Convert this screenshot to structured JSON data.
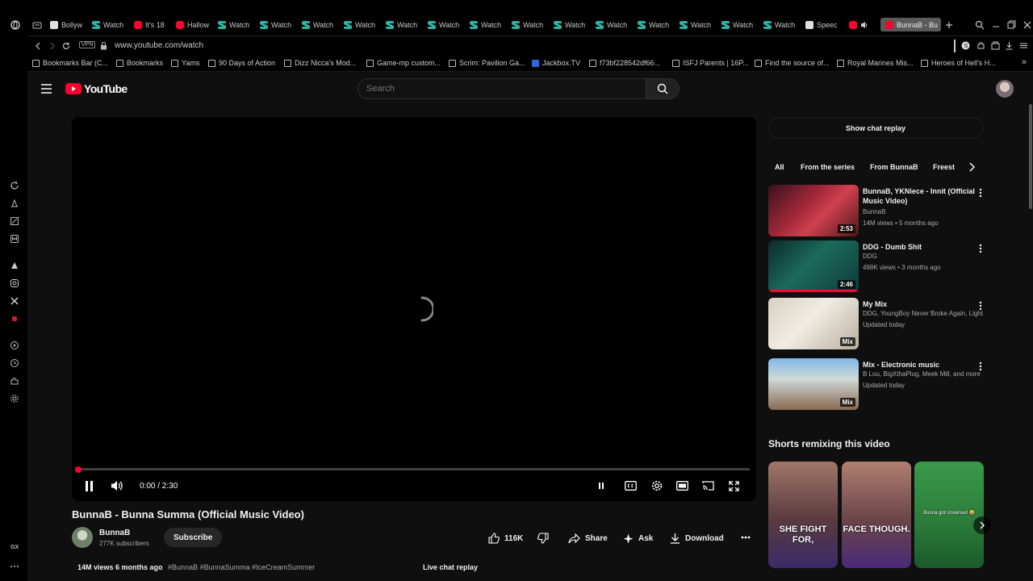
{
  "browser": {
    "tabs": [
      {
        "label": "Bollyw",
        "fav": "b"
      },
      {
        "label": "Watch",
        "fav": "s"
      },
      {
        "label": "It's 18",
        "fav": "yt"
      },
      {
        "label": "Hallow",
        "fav": "yt"
      },
      {
        "label": "Watch",
        "fav": "s"
      },
      {
        "label": "Watch",
        "fav": "s"
      },
      {
        "label": "Watch",
        "fav": "s"
      },
      {
        "label": "Watch",
        "fav": "s"
      },
      {
        "label": "Watch",
        "fav": "s"
      },
      {
        "label": "Watch",
        "fav": "s"
      },
      {
        "label": "Watch",
        "fav": "s"
      },
      {
        "label": "Watch",
        "fav": "s"
      },
      {
        "label": "Watch",
        "fav": "s"
      },
      {
        "label": "Watch",
        "fav": "s"
      },
      {
        "label": "Watch",
        "fav": "s"
      },
      {
        "label": "Watch",
        "fav": "s"
      },
      {
        "label": "Watch",
        "fav": "s"
      },
      {
        "label": "Watch",
        "fav": "s"
      },
      {
        "label": "Speec",
        "fav": "b"
      }
    ],
    "active_tab": "BunnaB - Bu",
    "vpn_label": "VPN",
    "url": "www.youtube.com/watch",
    "bookmarks": [
      "Bookmarks Bar (C...",
      "Bookmarks",
      "Yams",
      "90 Days of Action",
      "Dizz Nicca's Mod...",
      "Game-mp custom...",
      "Scrim: Pavilion Ga...",
      "Jackbox.TV",
      "f73bf228542df66...",
      "ISFJ Parents | 16P...",
      "Find the source of...",
      "Royal Marines Mis...",
      "Heroes of Hell's H..."
    ],
    "gx_label": "GX",
    "accent": "#ff0033"
  },
  "youtube": {
    "logo_text": "YouTube",
    "search_placeholder": "Search",
    "player": {
      "time": "0:00 / 2:30",
      "progress": 0.0
    },
    "video": {
      "title": "BunnaB - Bunna Summa (Official Music Video)",
      "channel": "BunnaB",
      "subscribers": "277K subscribers",
      "subscribe_label": "Subscribe",
      "likes": "116K",
      "share_label": "Share",
      "ask_label": "Ask",
      "download_label": "Download",
      "views_date": "14M views  6 months ago",
      "hashtags": "#BunnaB #BunnaSumma #IceCreamSummer",
      "live_chat_label": "Live chat replay"
    },
    "sidebar": {
      "chat_replay_button": "Show chat replay",
      "chips": [
        "All",
        "From the series",
        "From BunnaB",
        "Freest"
      ],
      "recommendations": [
        {
          "title": "BunnaB, YKNiece - Innit (Official Music Video)",
          "channel": "BunnaB",
          "stats": "14M views • 5 months ago",
          "badge": "2:53",
          "progress": 0.0
        },
        {
          "title": "DDG - Dumb Shit",
          "channel": "DDG",
          "stats": "498K views • 3 months ago",
          "badge": "2:46",
          "progress": 1.0
        },
        {
          "title": "My Mix",
          "channel": "DDG, YoungBoy Never Broke Again, Light...",
          "stats": "Updated today",
          "badge": "Mix",
          "progress": 0.0
        },
        {
          "title": "Mix - Electronic music",
          "channel": "B Lou, BigXthaPlug, Meek Mill, and more",
          "stats": "Updated today",
          "badge": "Mix",
          "progress": 0.0
        }
      ],
      "shorts_heading": "Shorts remixing this video",
      "shorts": [
        {
          "caption": "SHE FIGHT FOR,"
        },
        {
          "caption": "FACE THOUGH."
        },
        {
          "caption": "Bunna got Unversed 😂"
        }
      ]
    }
  }
}
